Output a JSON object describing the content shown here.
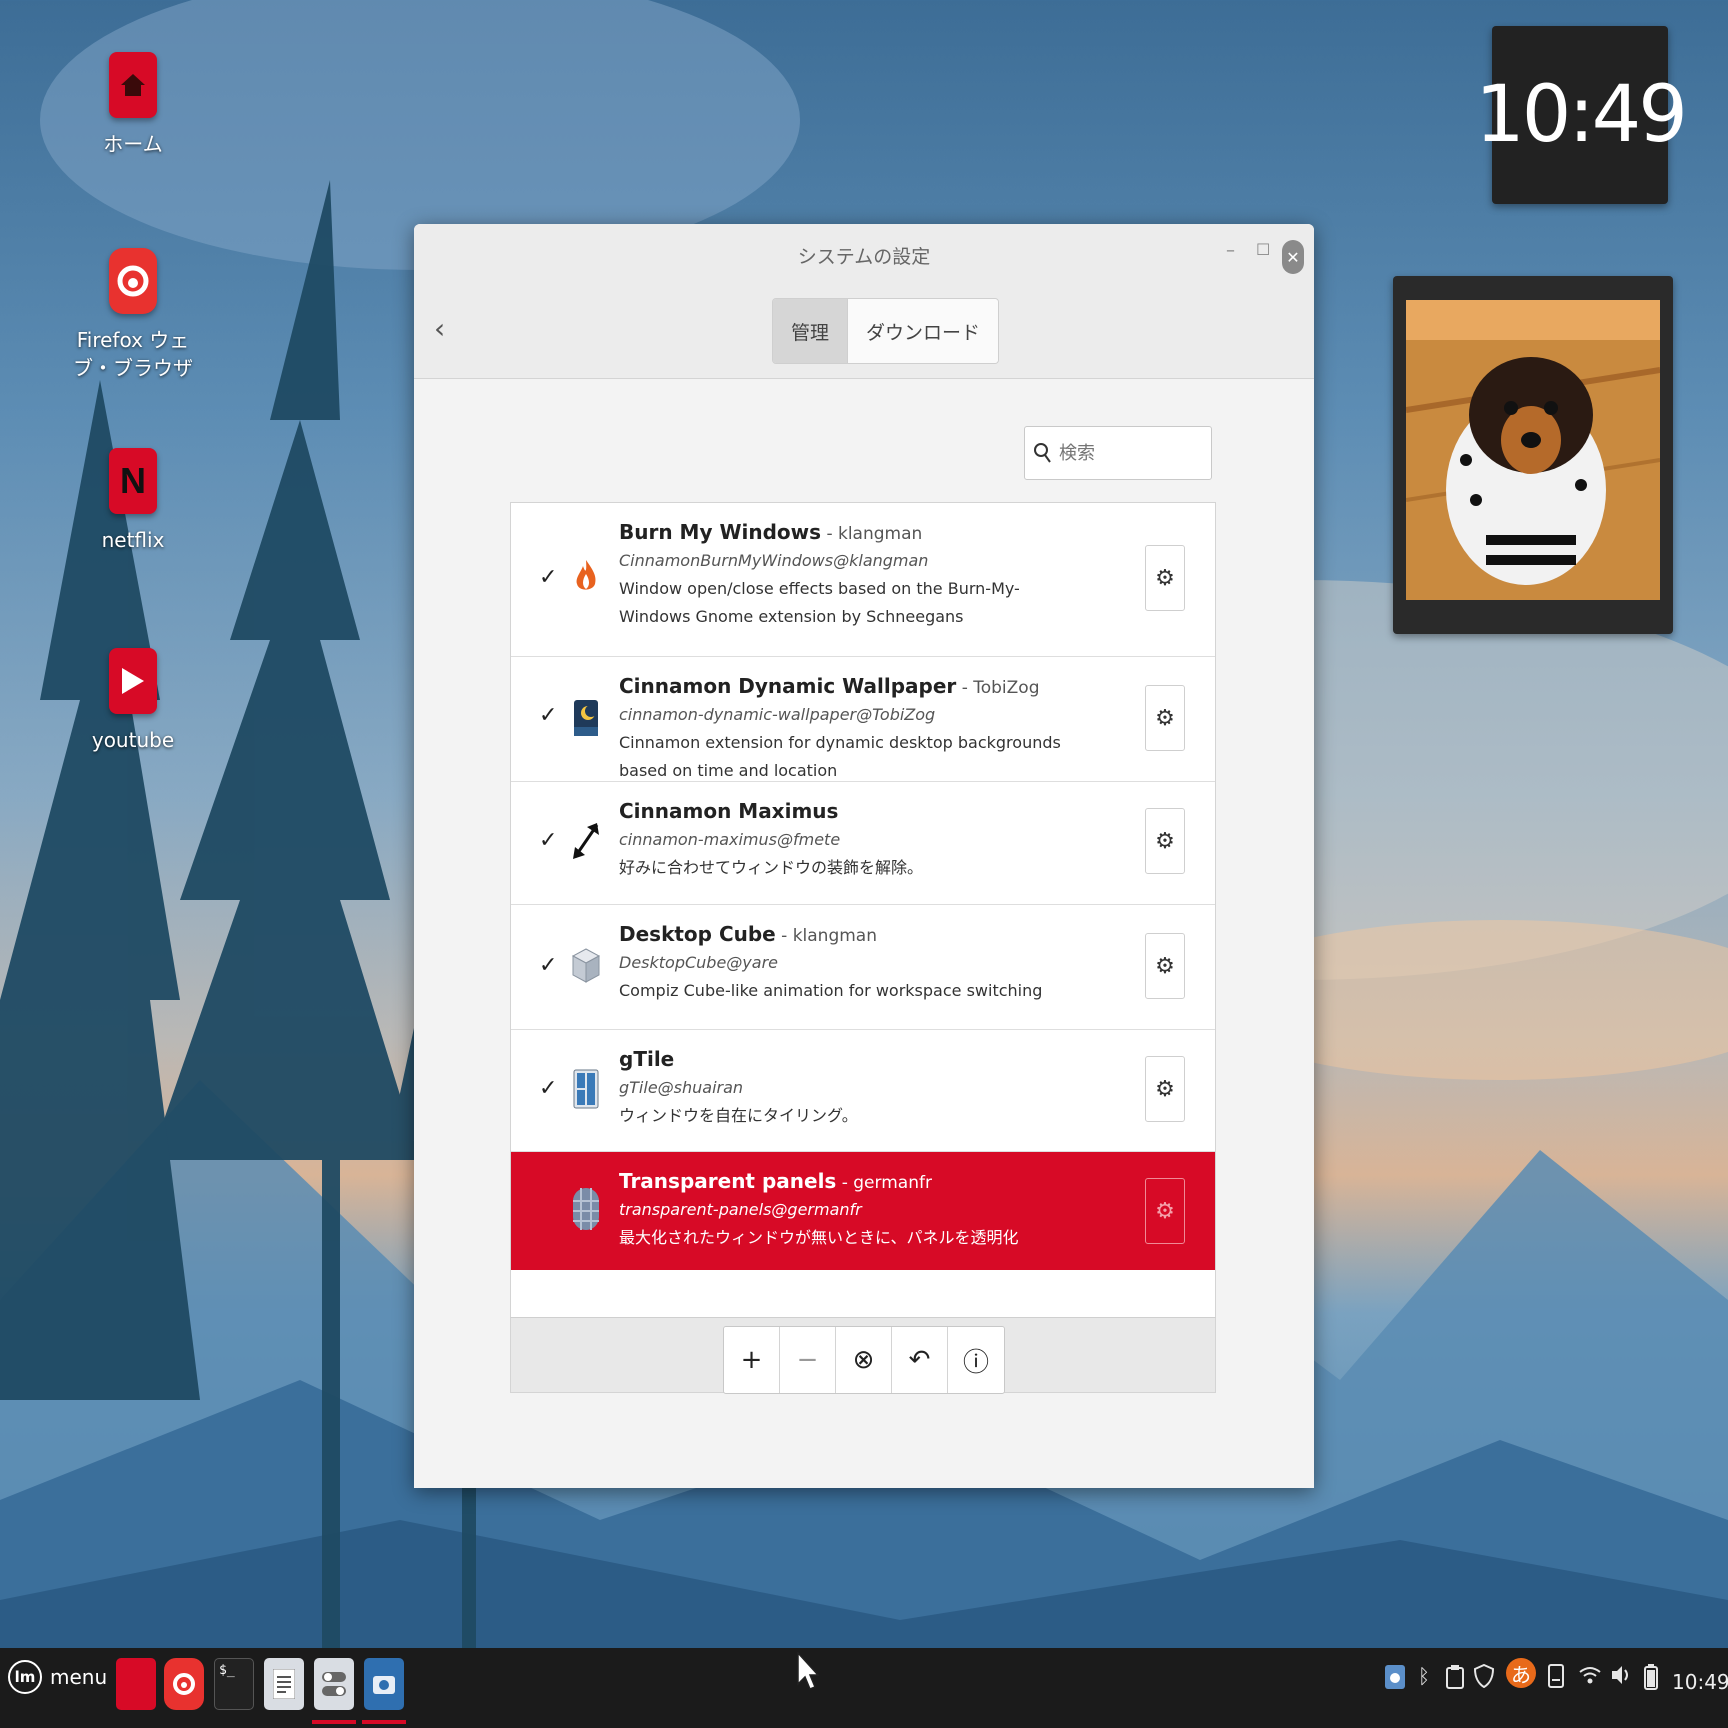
{
  "desktop": {
    "icons": [
      {
        "name": "home",
        "label": "ホーム",
        "color": "#d70a26"
      },
      {
        "name": "firefox",
        "label": "Firefox ウェブ・ブラウザ",
        "color": "#e8322f"
      },
      {
        "name": "netflix",
        "label": "netflix",
        "color": "#d70a26"
      },
      {
        "name": "youtube",
        "label": "youtube",
        "color": "#d70a26"
      }
    ],
    "clock_desklet": "10:49"
  },
  "window": {
    "title": "システムの設定",
    "tabs": [
      "管理",
      "ダウンロード"
    ],
    "search_placeholder": "検索",
    "extensions": [
      {
        "name": "Burn My Windows",
        "author": " - klangman",
        "uuid": "CinnamonBurnMyWindows@klangman",
        "description": "Window open/close effects based on the Burn-My-Windows Gnome extension by Schneegans",
        "enabled": true,
        "check": "✓"
      },
      {
        "name": "Cinnamon Dynamic Wallpaper",
        "author": " - TobiZog",
        "uuid": "cinnamon-dynamic-wallpaper@TobiZog",
        "description": "Cinnamon extension for dynamic desktop backgrounds based on time and location",
        "enabled": true,
        "check": "✓"
      },
      {
        "name": "Cinnamon Maximus",
        "author": "",
        "uuid": "cinnamon-maximus@fmete",
        "description": "好みに合わせてウィンドウの装飾を解除。",
        "enabled": true,
        "check": "✓"
      },
      {
        "name": "Desktop Cube",
        "author": " - klangman",
        "uuid": "DesktopCube@yare",
        "description": "Compiz Cube-like animation for workspace switching",
        "enabled": true,
        "check": "✓"
      },
      {
        "name": "gTile",
        "author": "",
        "uuid": "gTile@shuairan",
        "description": "ウィンドウを自在にタイリング。",
        "enabled": true,
        "check": "✓"
      },
      {
        "name": "Transparent panels",
        "author": " - germanfr",
        "uuid": "transparent-panels@germanfr",
        "description": "最大化されたウィンドウが無いときに、パネルを透明化",
        "enabled": false,
        "check": "",
        "selected": true
      }
    ],
    "toolbar": {
      "add": "+",
      "remove": "−",
      "clear": "⊗",
      "undo": "↶",
      "info": "ⓘ"
    }
  },
  "taskbar": {
    "menu_label": "menu",
    "logo": "lm",
    "time": "10:49",
    "ime": "あ",
    "accent": "#d70a26"
  }
}
